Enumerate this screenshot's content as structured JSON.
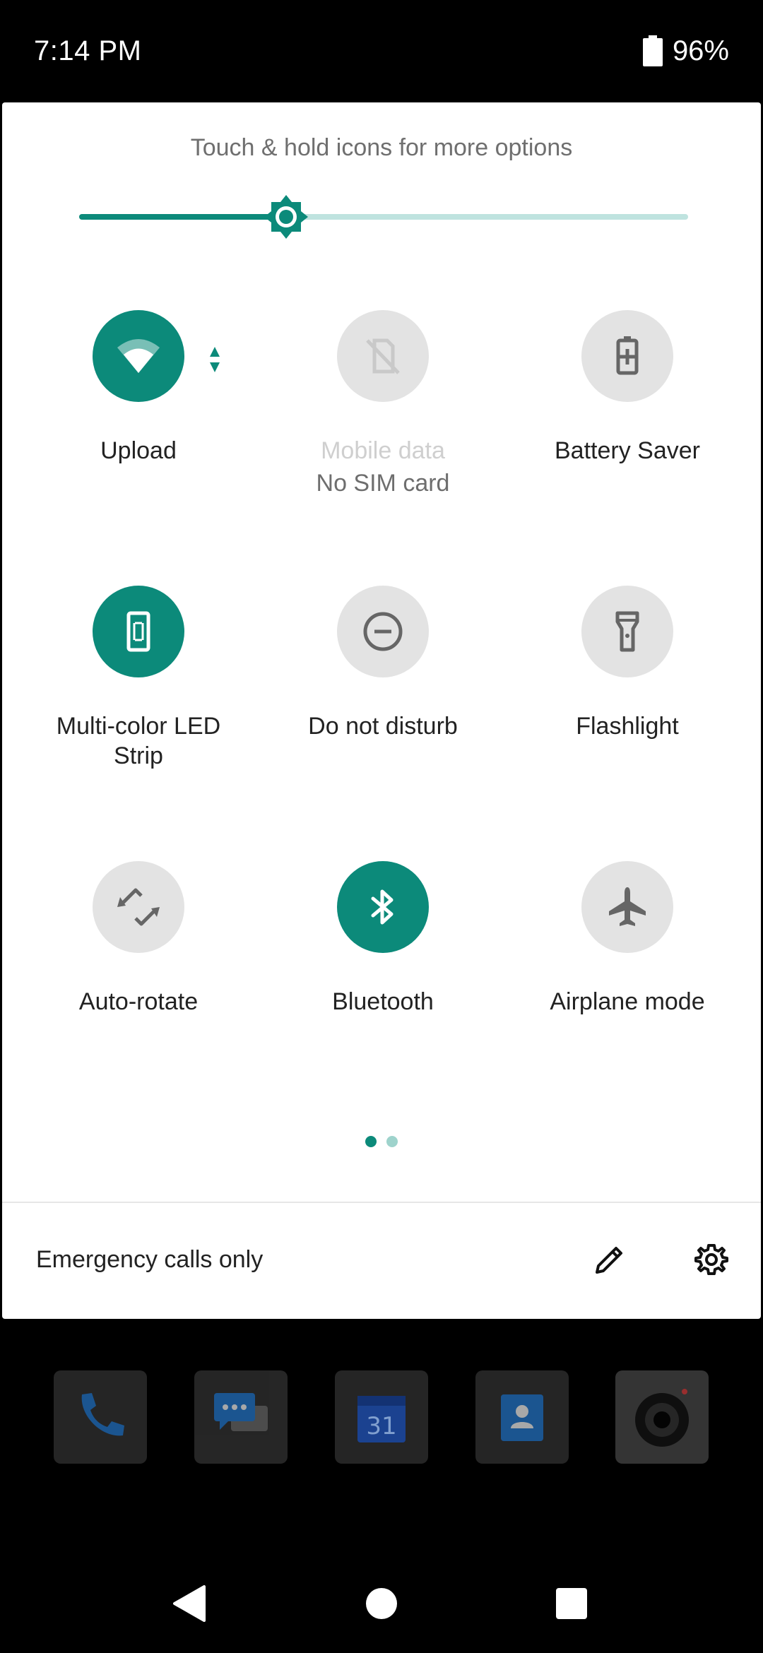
{
  "status_bar": {
    "time": "7:14 PM",
    "battery": "96%",
    "battery_icon": "battery-icon"
  },
  "quick_settings": {
    "hint": "Touch & hold icons for more options",
    "brightness_level": 0.34,
    "accent_color": "#0c8a7a",
    "tiles": [
      {
        "label": "Upload",
        "sublabel": "",
        "icon": "wifi-icon",
        "state": "on"
      },
      {
        "label": "Mobile data",
        "sublabel": "No SIM card",
        "icon": "no-sim-icon",
        "state": "unavailable"
      },
      {
        "label": "Battery Saver",
        "sublabel": "",
        "icon": "battery-saver-icon",
        "state": "off"
      },
      {
        "label": "Multi-color LED\nStrip",
        "sublabel": "",
        "icon": "led-strip-icon",
        "state": "on"
      },
      {
        "label": "Do not disturb",
        "sublabel": "",
        "icon": "do-not-disturb-icon",
        "state": "off"
      },
      {
        "label": "Flashlight",
        "sublabel": "",
        "icon": "flashlight-icon",
        "state": "off"
      },
      {
        "label": "Auto-rotate",
        "sublabel": "",
        "icon": "auto-rotate-icon",
        "state": "off"
      },
      {
        "label": "Bluetooth",
        "sublabel": "",
        "icon": "bluetooth-icon",
        "state": "on"
      },
      {
        "label": "Airplane mode",
        "sublabel": "",
        "icon": "airplane-icon",
        "state": "off"
      }
    ],
    "page_count": 2,
    "current_page": 1,
    "footer": {
      "carrier_text": "Emergency calls only",
      "edit_icon": "edit-pencil-icon",
      "settings_icon": "gear-icon"
    }
  },
  "dock": {
    "apps": [
      {
        "name": "Phone",
        "icon": "phone-icon"
      },
      {
        "name": "Messages",
        "icon": "messages-icon"
      },
      {
        "name": "Calendar",
        "icon": "calendar-icon",
        "badge_text": "31"
      },
      {
        "name": "Contacts",
        "icon": "contacts-icon"
      },
      {
        "name": "Camera",
        "icon": "camera-icon"
      }
    ]
  },
  "nav_bar": {
    "back_icon": "back-triangle-icon",
    "home_icon": "home-circle-icon",
    "recents_icon": "recents-square-icon"
  }
}
